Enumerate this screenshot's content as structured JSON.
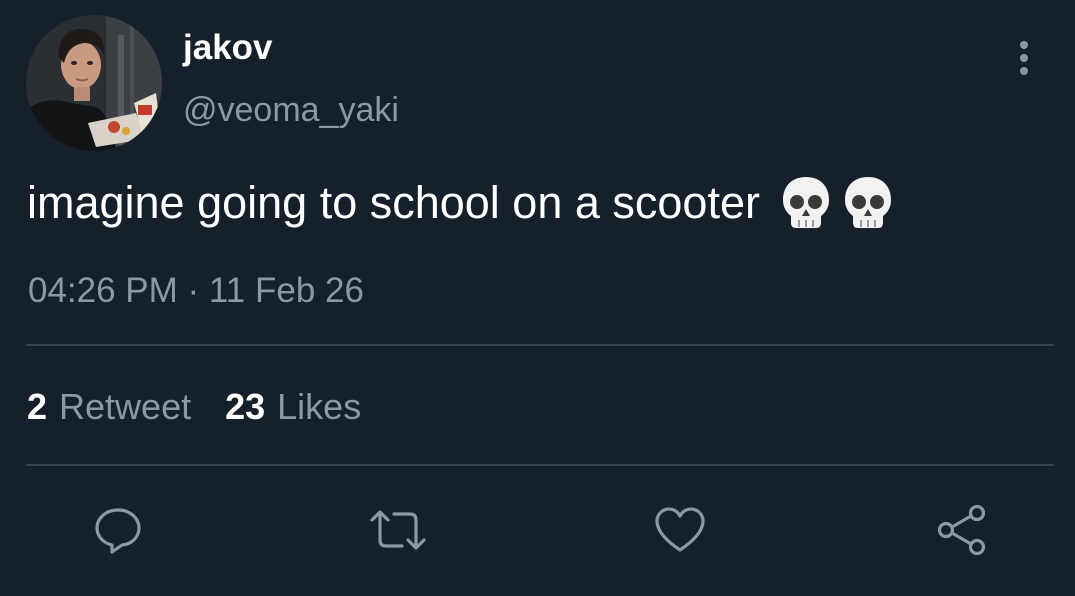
{
  "tweet": {
    "author": {
      "display_name": "jakov",
      "handle": "@veoma_yaki",
      "avatar": "profile-photo"
    },
    "text": "imagine going to school on a scooter",
    "emojis": [
      "skull",
      "skull"
    ],
    "timestamp": "04:26 PM · 11 Feb 26",
    "stats": {
      "retweets": {
        "count": "2",
        "label": "Retweet"
      },
      "likes": {
        "count": "23",
        "label": "Likes"
      }
    },
    "actions": [
      {
        "name": "reply",
        "icon": "reply-icon"
      },
      {
        "name": "retweet",
        "icon": "retweet-icon"
      },
      {
        "name": "like",
        "icon": "heart-icon"
      },
      {
        "name": "share",
        "icon": "share-icon"
      }
    ],
    "menu_icon": "more-vertical-icon"
  },
  "colors": {
    "background": "#15202b",
    "primary_text": "#ffffff",
    "secondary_text": "#8b98a5",
    "divider": "#38444d"
  }
}
